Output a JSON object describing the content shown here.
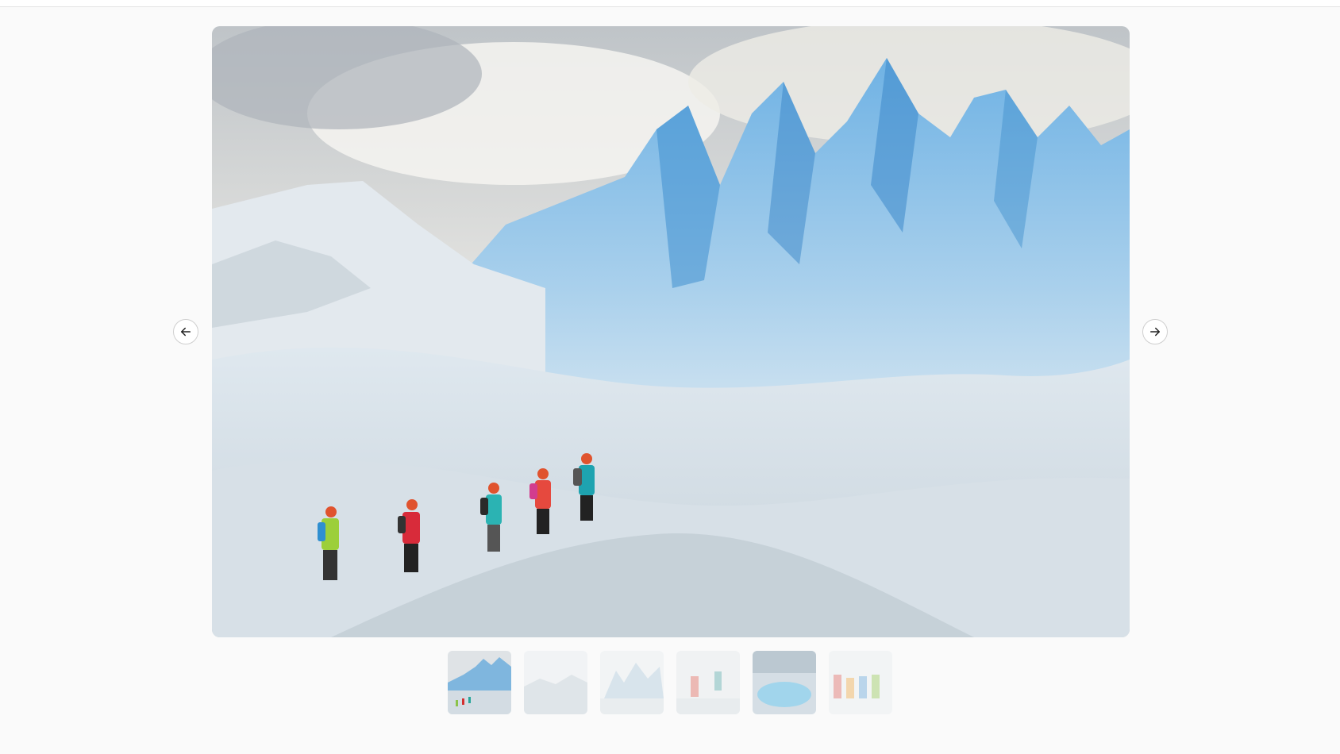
{
  "gallery": {
    "main_image": {
      "icon": "glacier-hikers-photo"
    },
    "prev_button": {
      "icon": "arrow-left-icon"
    },
    "next_button": {
      "icon": "arrow-right-icon"
    },
    "selected_index": 0,
    "thumbnails": [
      {
        "icon": "glacier-hikers-thumb",
        "selected": true
      },
      {
        "icon": "snowy-landscape-thumb",
        "selected": false
      },
      {
        "icon": "ice-peaks-thumb",
        "selected": false
      },
      {
        "icon": "people-on-ice-thumb",
        "selected": false
      },
      {
        "icon": "blue-lagoon-thumb",
        "selected": false
      },
      {
        "icon": "group-photo-thumb",
        "selected": false
      }
    ]
  },
  "colors": {
    "background": "#fafafa",
    "button_border": "#cfcfcf",
    "ice_blue": "#5fa3d6",
    "snow": "#e9eef2"
  }
}
